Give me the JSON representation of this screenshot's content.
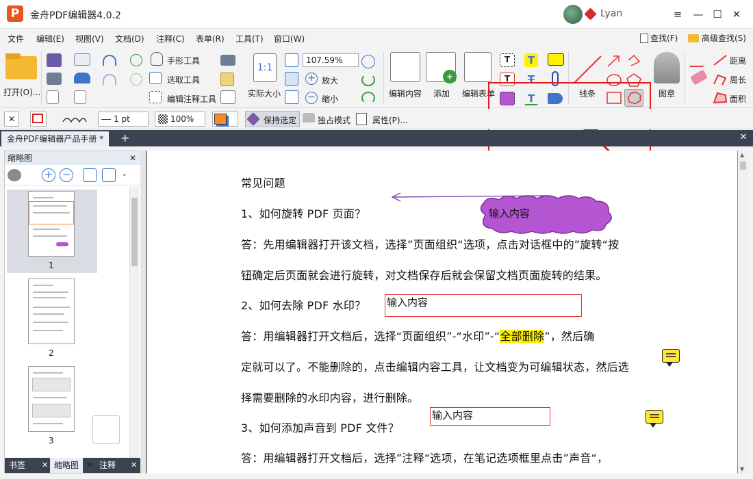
{
  "app": {
    "logo_letter": "P",
    "title": "金舟PDF编辑器4.0.2",
    "user_name": "Lyan"
  },
  "window_buttons": {
    "menu": "≡",
    "minimize": "—",
    "maximize": "☐",
    "close": "✕"
  },
  "menu": {
    "items": [
      "文件",
      "编辑(E)",
      "视图(V)",
      "文档(D)",
      "注释(C)",
      "表单(R)",
      "工具(T)",
      "窗口(W)"
    ],
    "find": "查找(F)",
    "advanced_find": "高级查找(S)"
  },
  "ribbon": {
    "open": "打开(O)...",
    "hand_tool": "手形工具",
    "select_text": "选取工具",
    "edit_annot": "编辑注释工具",
    "actual_size": "实际大小",
    "zoom_value": "107.59%",
    "zoom_in": "放大",
    "zoom_out": "缩小",
    "edit_content": "编辑内容",
    "add": "添加",
    "edit_form": "编辑表单",
    "lines": "线条",
    "stamp": "图章",
    "distance": "距离",
    "perimeter": "周长",
    "area": "面积",
    "actual_size_glyph": "1:1"
  },
  "formatbar": {
    "line_width": "1 pt",
    "opacity": "100%",
    "keep_selected": "保持选定",
    "exclusive_mode": "独占模式",
    "properties": "属性(P)..."
  },
  "tabs": {
    "document": "金舟PDF编辑器产品手册 *"
  },
  "left_panel": {
    "title": "缩略图",
    "page_numbers": [
      "1",
      "2",
      "3"
    ],
    "bottom_tabs": [
      "书签",
      "缩略图",
      "注释"
    ]
  },
  "document": {
    "lines": [
      "常见问题",
      "1、如何旋转 PDF 页面？",
      "答：先用编辑器打开该文档，选择”页面组织“选项，点击对话框中的”旋转“按",
      "钮确定后页面就会进行旋转，对文档保存后就会保留文档页面旋转的结果。",
      "2、如何去除 PDF 水印？",
      "答：用编辑器打开文档后，选择“页面组织”-“水印”-“",
      "全部删除",
      "”，然后确",
      "定就可以了。不能删除的，点击编辑内容工具，让文档变为可编辑状态，然后选",
      "择需要删除的水印内容，进行删除。",
      "3、如何添加声音到 PDF 文件？",
      "答：用编辑器打开文档后，选择”注释“选项，在笔记选项框里点击”声音“，"
    ],
    "cloud_text": "输入内容",
    "box1_text": "输入内容",
    "box2_text": "输入内容"
  },
  "colors": {
    "accent_red": "#e21b1b",
    "cloud_fill": "#b455d2",
    "note_yellow": "#ffe834",
    "highlight": "#fff200"
  }
}
